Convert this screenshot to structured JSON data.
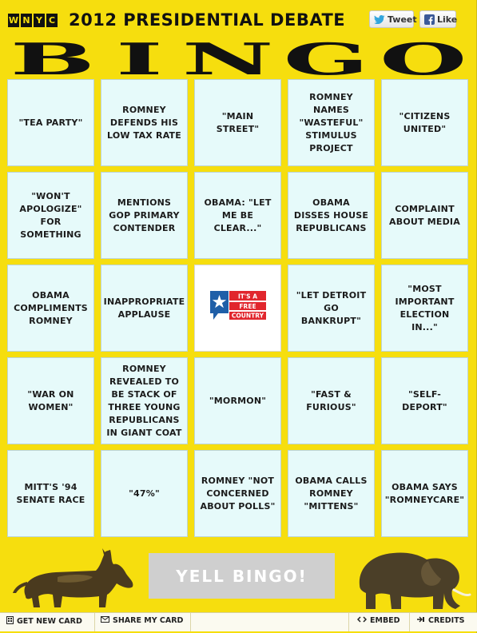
{
  "header": {
    "logo_letters": [
      "W",
      "N",
      "Y",
      "C"
    ],
    "title": "2012 PRESIDENTIAL DEBATE",
    "tweet_label": "Tweet",
    "like_label": "Like"
  },
  "banner": {
    "letters": [
      "B",
      "I",
      "N",
      "G",
      "O"
    ]
  },
  "card": {
    "cells": [
      "\"TEA PARTY\"",
      "ROMNEY DEFENDS HIS LOW TAX RATE",
      "\"MAIN STREET\"",
      "ROMNEY NAMES \"WASTEFUL\" STIMULUS PROJECT",
      "\"CITIZENS UNITED\"",
      "\"WON'T APOLOGIZE\" FOR SOMETHING",
      "MENTIONS GOP PRIMARY CONTENDER",
      "OBAMA: \"LET ME BE CLEAR...\"",
      "OBAMA DISSES HOUSE REPUBLICANS",
      "COMPLAINT ABOUT MEDIA",
      "OBAMA COMPLIMENTS ROMNEY",
      "INAPPROPRIATE APPLAUSE",
      "",
      "\"LET DETROIT GO BANKRUPT\"",
      "\"MOST IMPORTANT ELECTION IN...\"",
      "\"WAR ON WOMEN\"",
      "ROMNEY REVEALED TO BE STACK OF THREE YOUNG REPUBLICANS IN GIANT COAT",
      "\"MORMON\"",
      "\"FAST & FURIOUS\"",
      "\"SELF-DEPORT\"",
      "MITT'S '94 SENATE RACE",
      "\"47%\"",
      "ROMNEY \"NOT CONCERNED ABOUT POLLS\"",
      "OBAMA CALLS ROMNEY \"MITTENS\"",
      "OBAMA SAYS \"ROMNEYCARE\""
    ],
    "free_space": {
      "logo_lines": [
        "IT'S A",
        "FREE",
        "COUNTRY"
      ],
      "colors": {
        "red": "#e1262d",
        "blue": "#1f5fa8"
      }
    }
  },
  "yell_button": "YELL BINGO!",
  "footer": {
    "get_new_card": "GET NEW CARD",
    "share_card": "SHARE MY CARD",
    "embed": "EMBED",
    "credits": "CREDITS"
  },
  "colors": {
    "background_yellow": "#f6de0e",
    "cell_fill": "#e6fafa",
    "yell_button_gray": "#cfcfcf"
  }
}
